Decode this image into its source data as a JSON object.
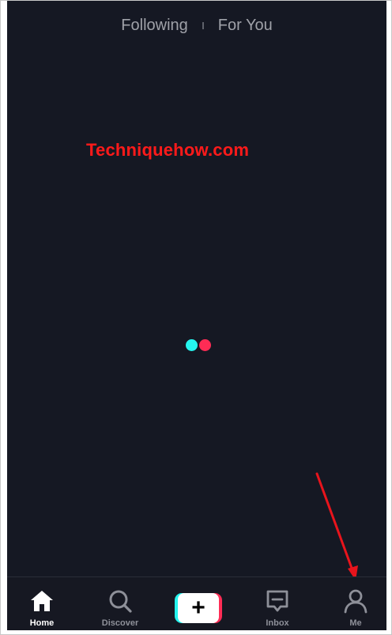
{
  "top_tabs": {
    "following": "Following",
    "for_you": "For You"
  },
  "watermark": "Techniquehow.com",
  "loader": {
    "dot_colors": [
      "#25f4ee",
      "#fe2c55"
    ]
  },
  "bottom_nav": {
    "items": [
      {
        "label": "Home",
        "icon": "home-icon",
        "active": true
      },
      {
        "label": "Discover",
        "icon": "search-icon",
        "active": false
      },
      {
        "label": "",
        "icon": "plus-icon",
        "active": false
      },
      {
        "label": "Inbox",
        "icon": "inbox-icon",
        "active": false
      },
      {
        "label": "Me",
        "icon": "profile-icon",
        "active": false
      }
    ],
    "create_symbol": "+"
  },
  "annotation": {
    "arrow_color": "#e8141c",
    "points_to": "Me"
  },
  "colors": {
    "background": "#151823",
    "watermark": "#ff1a1a",
    "accent_cyan": "#25f4ee",
    "accent_red": "#fe2c55"
  }
}
